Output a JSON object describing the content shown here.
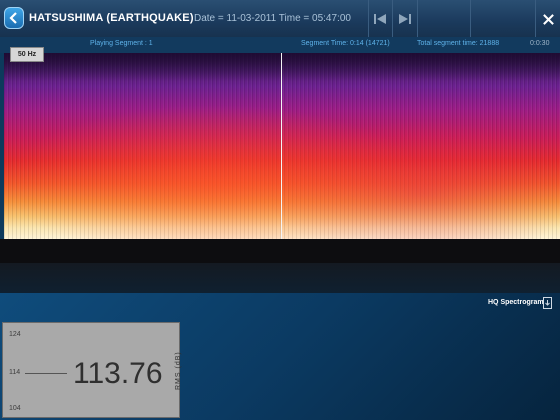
{
  "header": {
    "title": "HATSUSHIMA (EARTHQUAKE)",
    "date_time": "Date = 11-03-2011   Time = 05:47:00",
    "icons": [
      "back-icon",
      "skip-start-icon",
      "skip-end-icon",
      "close-icon"
    ]
  },
  "info": {
    "playing_segment": "Playing Segment : 1",
    "segment_time": "Segment Time: 0:14  (14721)",
    "total_segment_time": "Total segment time: 21888",
    "clock": "0:0:30"
  },
  "spectrogram": {
    "frequency_label": "50 Hz",
    "mode_label": "HQ Spectrogram"
  },
  "meter": {
    "scale_top": "124",
    "scale_mid": "114",
    "scale_bottom": "104",
    "value": "113.76",
    "unit": "RMS  (dB)"
  }
}
